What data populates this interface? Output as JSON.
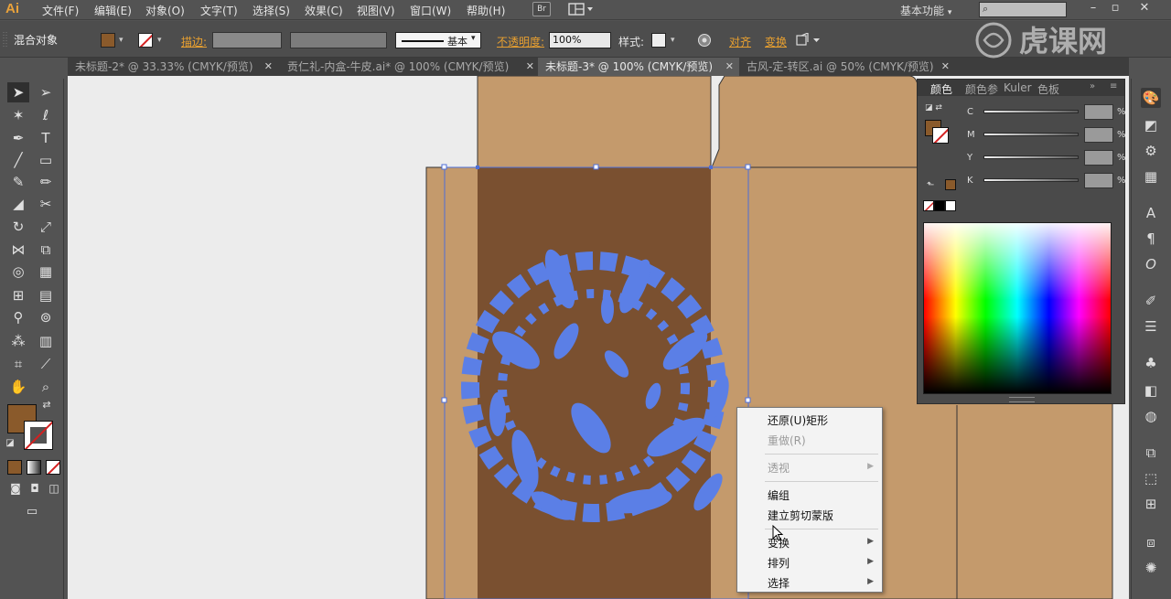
{
  "app": {
    "logo": "Ai"
  },
  "menu": [
    "文件(F)",
    "编辑(E)",
    "对象(O)",
    "文字(T)",
    "选择(S)",
    "效果(C)",
    "视图(V)",
    "窗口(W)",
    "帮助(H)"
  ],
  "bridge_label": "Br",
  "workspace": "基本功能",
  "watermark": "虎课网",
  "control": {
    "selection_label": "混合对象",
    "stroke_link": "描边:",
    "stroke_style": "基本",
    "opacity_link": "不透明度:",
    "opacity_value": "100%",
    "style_label": "样式:",
    "align_link": "对齐",
    "transform_link": "变换"
  },
  "tabs": [
    {
      "label": "未标题-2* @ 33.33% (CMYK/预览)",
      "active": false
    },
    {
      "label": "贡仁礼-内盒-牛皮.ai* @ 100% (CMYK/预览)",
      "active": false
    },
    {
      "label": "未标题-3* @ 100% (CMYK/预览)",
      "active": true
    },
    {
      "label": "古风-定-转区.ai @ 50% (CMYK/预览)",
      "active": false
    }
  ],
  "color_panel": {
    "tabs": [
      "颜色",
      "颜色参",
      "Kuler",
      "色板"
    ],
    "channels": [
      {
        "label": "C",
        "unit": "%"
      },
      {
        "label": "M",
        "unit": "%"
      },
      {
        "label": "Y",
        "unit": "%"
      },
      {
        "label": "K",
        "unit": "%"
      }
    ]
  },
  "context_menu": {
    "items": [
      {
        "label": "还原(U)矩形",
        "disabled": false,
        "submenu": false
      },
      {
        "label": "重做(R)",
        "disabled": true,
        "submenu": false
      },
      {
        "label": "透视",
        "disabled": true,
        "submenu": true
      },
      {
        "label": "编组",
        "disabled": false,
        "submenu": false
      },
      {
        "label": "建立剪切蒙版",
        "disabled": false,
        "submenu": false
      },
      {
        "label": "变换",
        "disabled": false,
        "submenu": true
      },
      {
        "label": "排列",
        "disabled": false,
        "submenu": true
      },
      {
        "label": "选择",
        "disabled": false,
        "submenu": true
      }
    ]
  },
  "colors": {
    "fill": "#8a5a2b",
    "kraft": "#c49a6c",
    "kraft_dark": "#7a5030",
    "artwork_blue": "#5b7fe6",
    "accent_orange": "#e8a030"
  }
}
